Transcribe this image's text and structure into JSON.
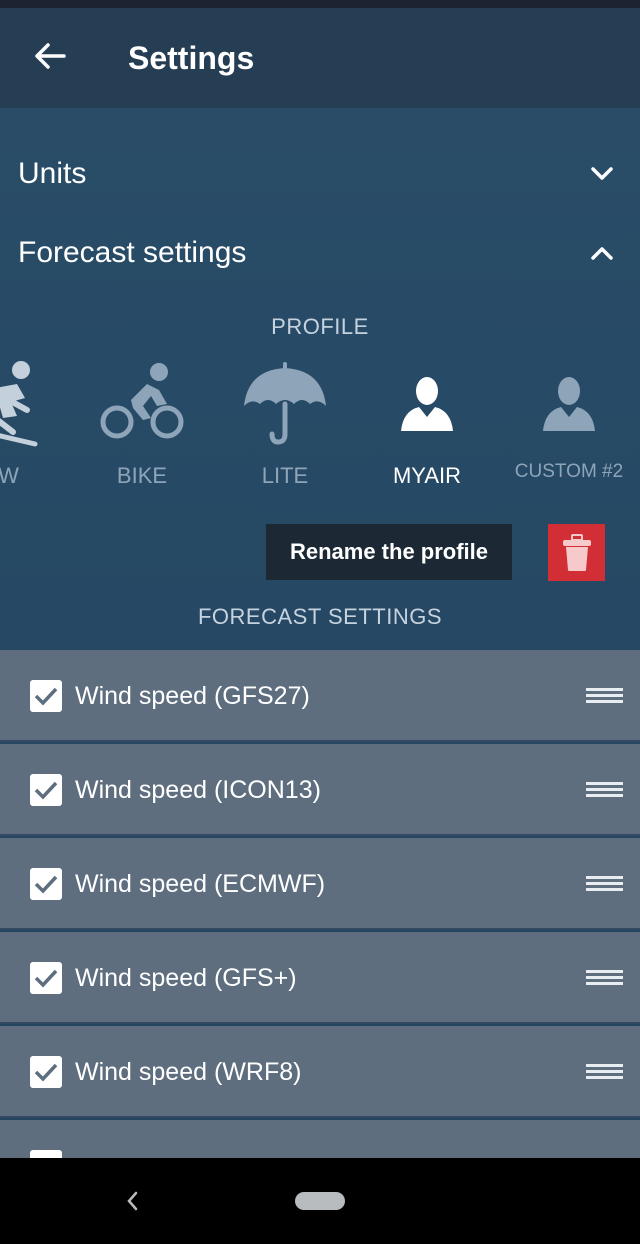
{
  "header": {
    "title": "Settings",
    "back_icon": "arrow-left-icon"
  },
  "sections": {
    "units": {
      "label": "Units",
      "state": "collapsed",
      "icon": "chevron-down-icon"
    },
    "forecast": {
      "label": "Forecast settings",
      "state": "expanded",
      "icon": "chevron-up-icon"
    }
  },
  "profile": {
    "heading": "PROFILE",
    "items": [
      {
        "label": "OW",
        "icon": "skier-icon",
        "active": false
      },
      {
        "label": "BIKE",
        "icon": "cyclist-icon",
        "active": false
      },
      {
        "label": "LITE",
        "icon": "umbrella-icon",
        "active": false
      },
      {
        "label": "MYAIR",
        "icon": "user-icon",
        "active": true
      },
      {
        "label": "CUSTOM #2",
        "icon": "user-icon",
        "active": false
      }
    ],
    "rename_label": "Rename the profile",
    "delete_icon": "trash-icon"
  },
  "forecast_settings": {
    "heading": "FORECAST SETTINGS",
    "items": [
      {
        "label": "Wind speed (GFS27)",
        "checked": true
      },
      {
        "label": "Wind speed (ICON13)",
        "checked": true
      },
      {
        "label": "Wind speed (ECMWF)",
        "checked": true
      },
      {
        "label": "Wind speed (GFS+)",
        "checked": true
      },
      {
        "label": "Wind speed (WRF8)",
        "checked": true
      },
      {
        "label": "",
        "checked": true
      }
    ]
  },
  "colors": {
    "accent_delete": "#d22e35",
    "header_bg": "#263e53",
    "list_bg": "#5e6e7f"
  }
}
